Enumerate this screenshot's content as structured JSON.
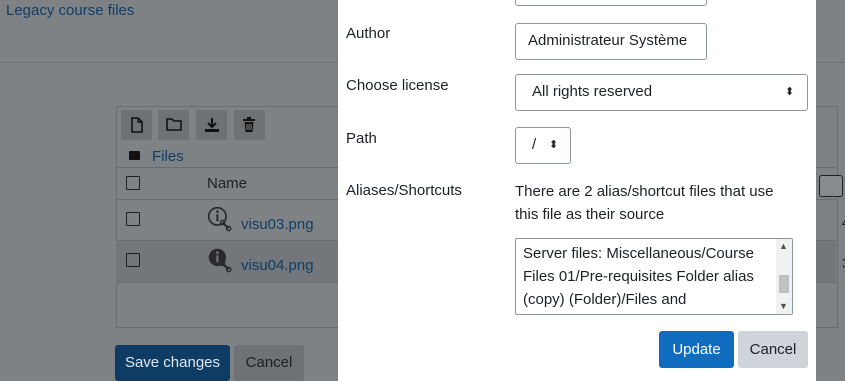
{
  "background": {
    "header_link": "Legacy course files",
    "breadcrumb": "Files",
    "table": {
      "name_header": "Name",
      "rows": [
        {
          "filename": "visu03.png",
          "right_value": "4"
        },
        {
          "filename": "visu04.png",
          "right_value": "3"
        }
      ]
    },
    "save_label": "Save changes",
    "cancel_label": "Cancel",
    "icons": [
      "new-file-icon",
      "new-folder-icon",
      "download-icon",
      "delete-icon",
      "folder-icon",
      "file-alias-icon"
    ]
  },
  "modal": {
    "author": {
      "label": "Author",
      "value": "Administrateur Système"
    },
    "license": {
      "label": "Choose license",
      "value": "All rights reserved"
    },
    "path": {
      "label": "Path",
      "value": "/"
    },
    "aliases": {
      "label": "Aliases/Shortcuts",
      "info": "There are 2 alias/shortcut files that use this file as their source",
      "list_text": "Server files: Miscellaneous/Course Files 01/Pre-requisites Folder alias (copy) (Folder)/Files and"
    },
    "update_label": "Update",
    "cancel_label": "Cancel"
  },
  "colors": {
    "primary": "#0f6cbf",
    "secondary": "#ced4da",
    "link": "#0f6cbf",
    "overlay": "#7f8285"
  }
}
